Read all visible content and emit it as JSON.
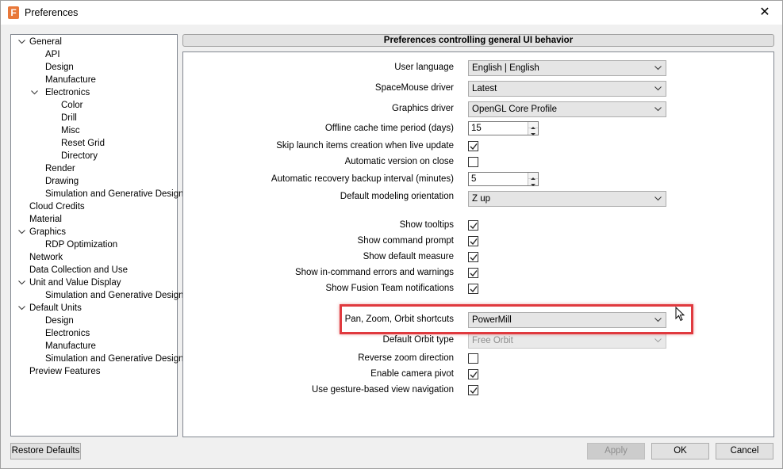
{
  "window": {
    "title": "Preferences",
    "app_icon_glyph": "F",
    "close_glyph": "✕"
  },
  "tree": {
    "items": [
      {
        "label": "General",
        "level": 0,
        "expanded": true
      },
      {
        "label": "API",
        "level": 1
      },
      {
        "label": "Design",
        "level": 1
      },
      {
        "label": "Manufacture",
        "level": 1
      },
      {
        "label": "Electronics",
        "level": 1,
        "expanded": true
      },
      {
        "label": "Color",
        "level": 2
      },
      {
        "label": "Drill",
        "level": 2
      },
      {
        "label": "Misc",
        "level": 2
      },
      {
        "label": "Reset Grid",
        "level": 2
      },
      {
        "label": "Directory",
        "level": 2
      },
      {
        "label": "Render",
        "level": 1
      },
      {
        "label": "Drawing",
        "level": 1
      },
      {
        "label": "Simulation and Generative Design",
        "level": 1
      },
      {
        "label": "Cloud Credits",
        "level": 0
      },
      {
        "label": "Material",
        "level": 0
      },
      {
        "label": "Graphics",
        "level": 0,
        "expanded": true
      },
      {
        "label": "RDP Optimization",
        "level": 1
      },
      {
        "label": "Network",
        "level": 0
      },
      {
        "label": "Data Collection and Use",
        "level": 0
      },
      {
        "label": "Unit and Value Display",
        "level": 0,
        "expanded": true
      },
      {
        "label": "Simulation and Generative Design",
        "level": 1
      },
      {
        "label": "Default Units",
        "level": 0,
        "expanded": true
      },
      {
        "label": "Design",
        "level": 1
      },
      {
        "label": "Electronics",
        "level": 1
      },
      {
        "label": "Manufacture",
        "level": 1
      },
      {
        "label": "Simulation and Generative Design",
        "level": 1
      },
      {
        "label": "Preview Features",
        "level": 0
      }
    ]
  },
  "main": {
    "header": "Preferences controlling general UI behavior",
    "settings": {
      "user_language": {
        "label": "User language",
        "value": "English | English"
      },
      "spacemouse_driver": {
        "label": "SpaceMouse driver",
        "value": "Latest"
      },
      "graphics_driver": {
        "label": "Graphics driver",
        "value": "OpenGL Core Profile"
      },
      "offline_cache": {
        "label": "Offline cache time period (days)",
        "value": "15"
      },
      "skip_launch": {
        "label": "Skip launch items creation when live update",
        "checked": true
      },
      "auto_version": {
        "label": "Automatic version on close",
        "checked": false
      },
      "auto_recovery": {
        "label": "Automatic recovery backup interval (minutes)",
        "value": "5"
      },
      "default_orientation": {
        "label": "Default modeling orientation",
        "value": "Z up"
      },
      "show_tooltips": {
        "label": "Show tooltips",
        "checked": true
      },
      "show_command_prompt": {
        "label": "Show command prompt",
        "checked": true
      },
      "show_default_measure": {
        "label": "Show default measure",
        "checked": true
      },
      "show_errors": {
        "label": "Show in-command errors and warnings",
        "checked": true
      },
      "show_fusion_team": {
        "label": "Show Fusion Team notifications",
        "checked": true
      },
      "pan_zoom_orbit": {
        "label": "Pan, Zoom, Orbit shortcuts",
        "value": "PowerMill"
      },
      "default_orbit": {
        "label": "Default Orbit type",
        "value": "Free Orbit",
        "disabled": true
      },
      "reverse_zoom": {
        "label": "Reverse zoom direction",
        "checked": false
      },
      "camera_pivot": {
        "label": "Enable camera pivot",
        "checked": true
      },
      "gesture_nav": {
        "label": "Use gesture-based view navigation",
        "checked": true
      }
    }
  },
  "footer": {
    "restore_defaults": "Restore Defaults",
    "apply": "Apply",
    "ok": "OK",
    "cancel": "Cancel"
  },
  "colors": {
    "highlight_border": "#e0393e",
    "accent": "#0078d7"
  }
}
